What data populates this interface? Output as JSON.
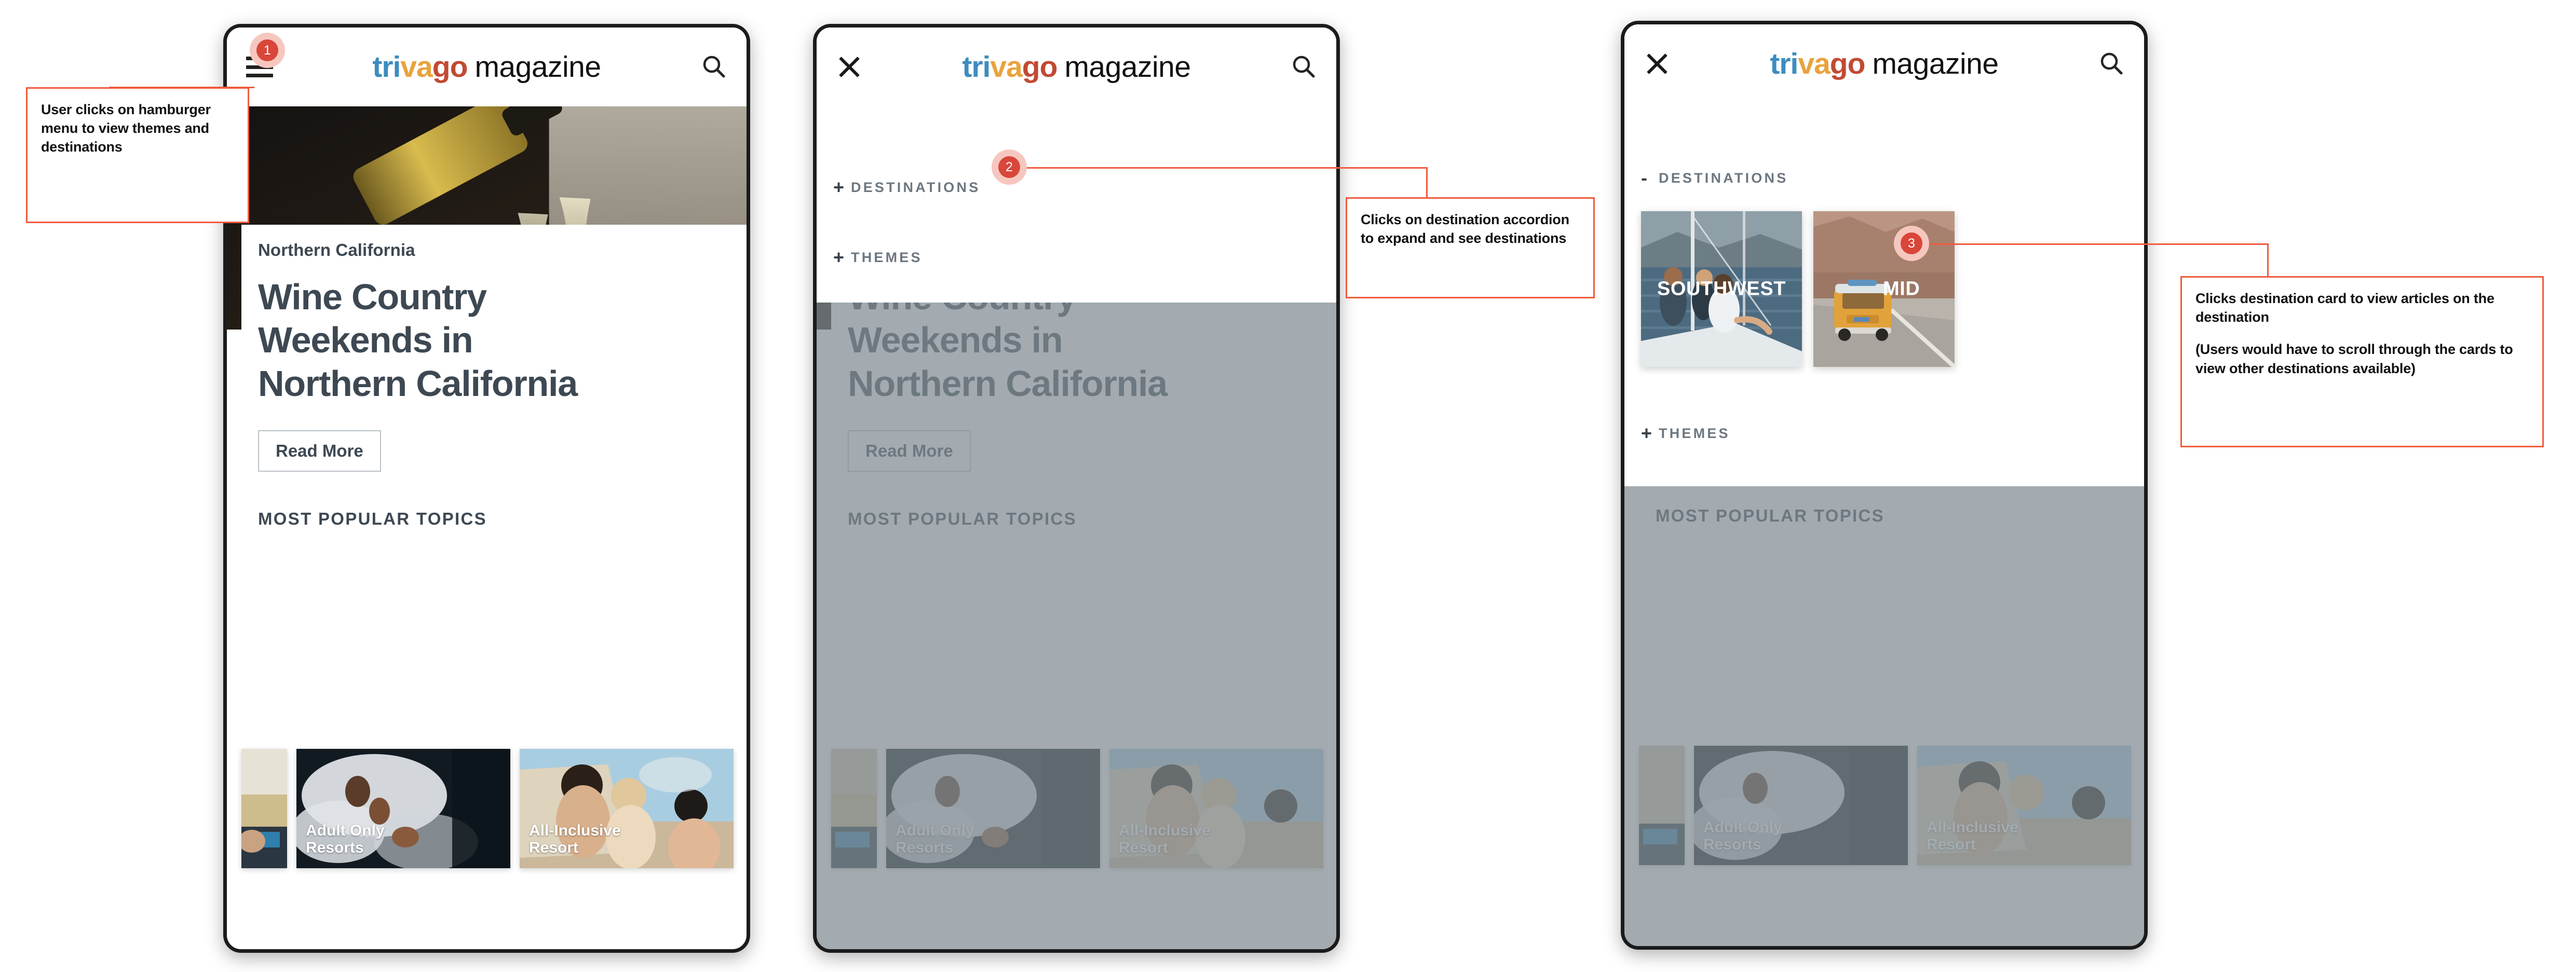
{
  "meta": {
    "accent_color": "#f05b3c",
    "badge_color": "#d9463a",
    "badge_halo_color": "#f6c7bf",
    "text_dark": "#3d4852"
  },
  "brand": {
    "part1": "tri",
    "part2": "va",
    "part3": "go",
    "suffix": "magazine"
  },
  "icons": {
    "hamburger": "hamburger-menu-icon",
    "close": "close-icon",
    "search": "search-icon"
  },
  "article": {
    "kicker": "Northern California",
    "headline": "Wine Country\nWeekends in\nNorthern California",
    "read_more": "Read More",
    "section_title": "MOST POPULAR TOPICS"
  },
  "topics": [
    {
      "label": "",
      "name": "topic-card-partial"
    },
    {
      "label": "Adult Only\nResorts",
      "name": "topic-card-adult-only-resorts"
    },
    {
      "label": "All-Inclusive\nResort",
      "name": "topic-card-all-inclusive-resort"
    }
  ],
  "menu": {
    "destinations_collapsed": {
      "sign": "+",
      "label": "DESTINATIONS"
    },
    "destinations_expanded": {
      "sign": "-",
      "label": "DESTINATIONS"
    },
    "themes": {
      "sign": "+",
      "label": "THEMES"
    }
  },
  "destinations": [
    {
      "label": "SOUTHWEST"
    },
    {
      "label": "MID"
    }
  ],
  "annotations": [
    {
      "number": "1",
      "lines": [
        "User clicks on hamburger menu to view themes and destinations"
      ]
    },
    {
      "number": "2",
      "lines": [
        "Clicks on destination accordion to expand and see destinations"
      ]
    },
    {
      "number": "3",
      "lines": [
        "Clicks destination card to view articles on the destination",
        "(Users would have to scroll through the cards to view other destinations available)"
      ]
    }
  ]
}
